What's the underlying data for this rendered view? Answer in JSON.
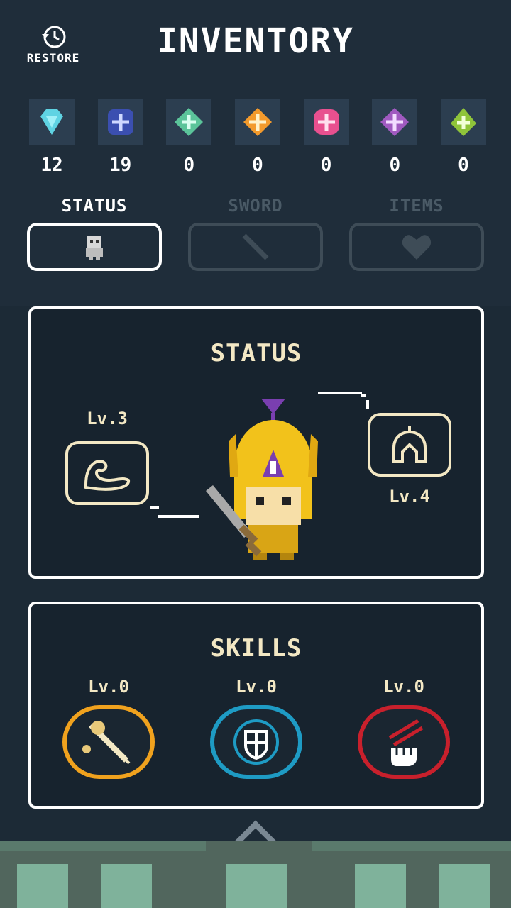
{
  "header": {
    "title": "INVENTORY",
    "restore_label": "RESTORE"
  },
  "gems": [
    {
      "name": "diamond-gem",
      "color": "#5fd3e3",
      "count": "12"
    },
    {
      "name": "sapphire-gem",
      "color": "#3b4fb0",
      "count": "19"
    },
    {
      "name": "emerald-gem",
      "color": "#5bc49a",
      "count": "0"
    },
    {
      "name": "topaz-gem",
      "color": "#f39a2c",
      "count": "0"
    },
    {
      "name": "ruby-gem",
      "color": "#e8508f",
      "count": "0"
    },
    {
      "name": "amethyst-gem",
      "color": "#a05ac0",
      "count": "0"
    },
    {
      "name": "peridot-gem",
      "color": "#8fc43a",
      "count": "0"
    }
  ],
  "tabs": [
    {
      "label": "STATUS",
      "active": true,
      "icon": "character-icon"
    },
    {
      "label": "SWORD",
      "active": false,
      "icon": "sword-icon"
    },
    {
      "label": "ITEMS",
      "active": false,
      "icon": "heart-icon"
    }
  ],
  "status_panel": {
    "title": "STATUS",
    "left_equip": {
      "level": "Lv.3",
      "icon": "strength-arm-icon"
    },
    "right_equip": {
      "level": "Lv.4",
      "icon": "helmet-icon"
    }
  },
  "skills_panel": {
    "title": "SKILLS",
    "skills": [
      {
        "level": "Lv.0",
        "icon": "sword-slash-icon",
        "color": "#f0a21e"
      },
      {
        "level": "Lv.0",
        "icon": "shield-icon",
        "color": "#1e9bc4"
      },
      {
        "level": "Lv.0",
        "icon": "fist-icon",
        "color": "#c8202c"
      }
    ]
  },
  "colors": {
    "background": "#1c2a36",
    "accent_text": "#f3e8c4",
    "hero_gold": "#f2c21b"
  }
}
